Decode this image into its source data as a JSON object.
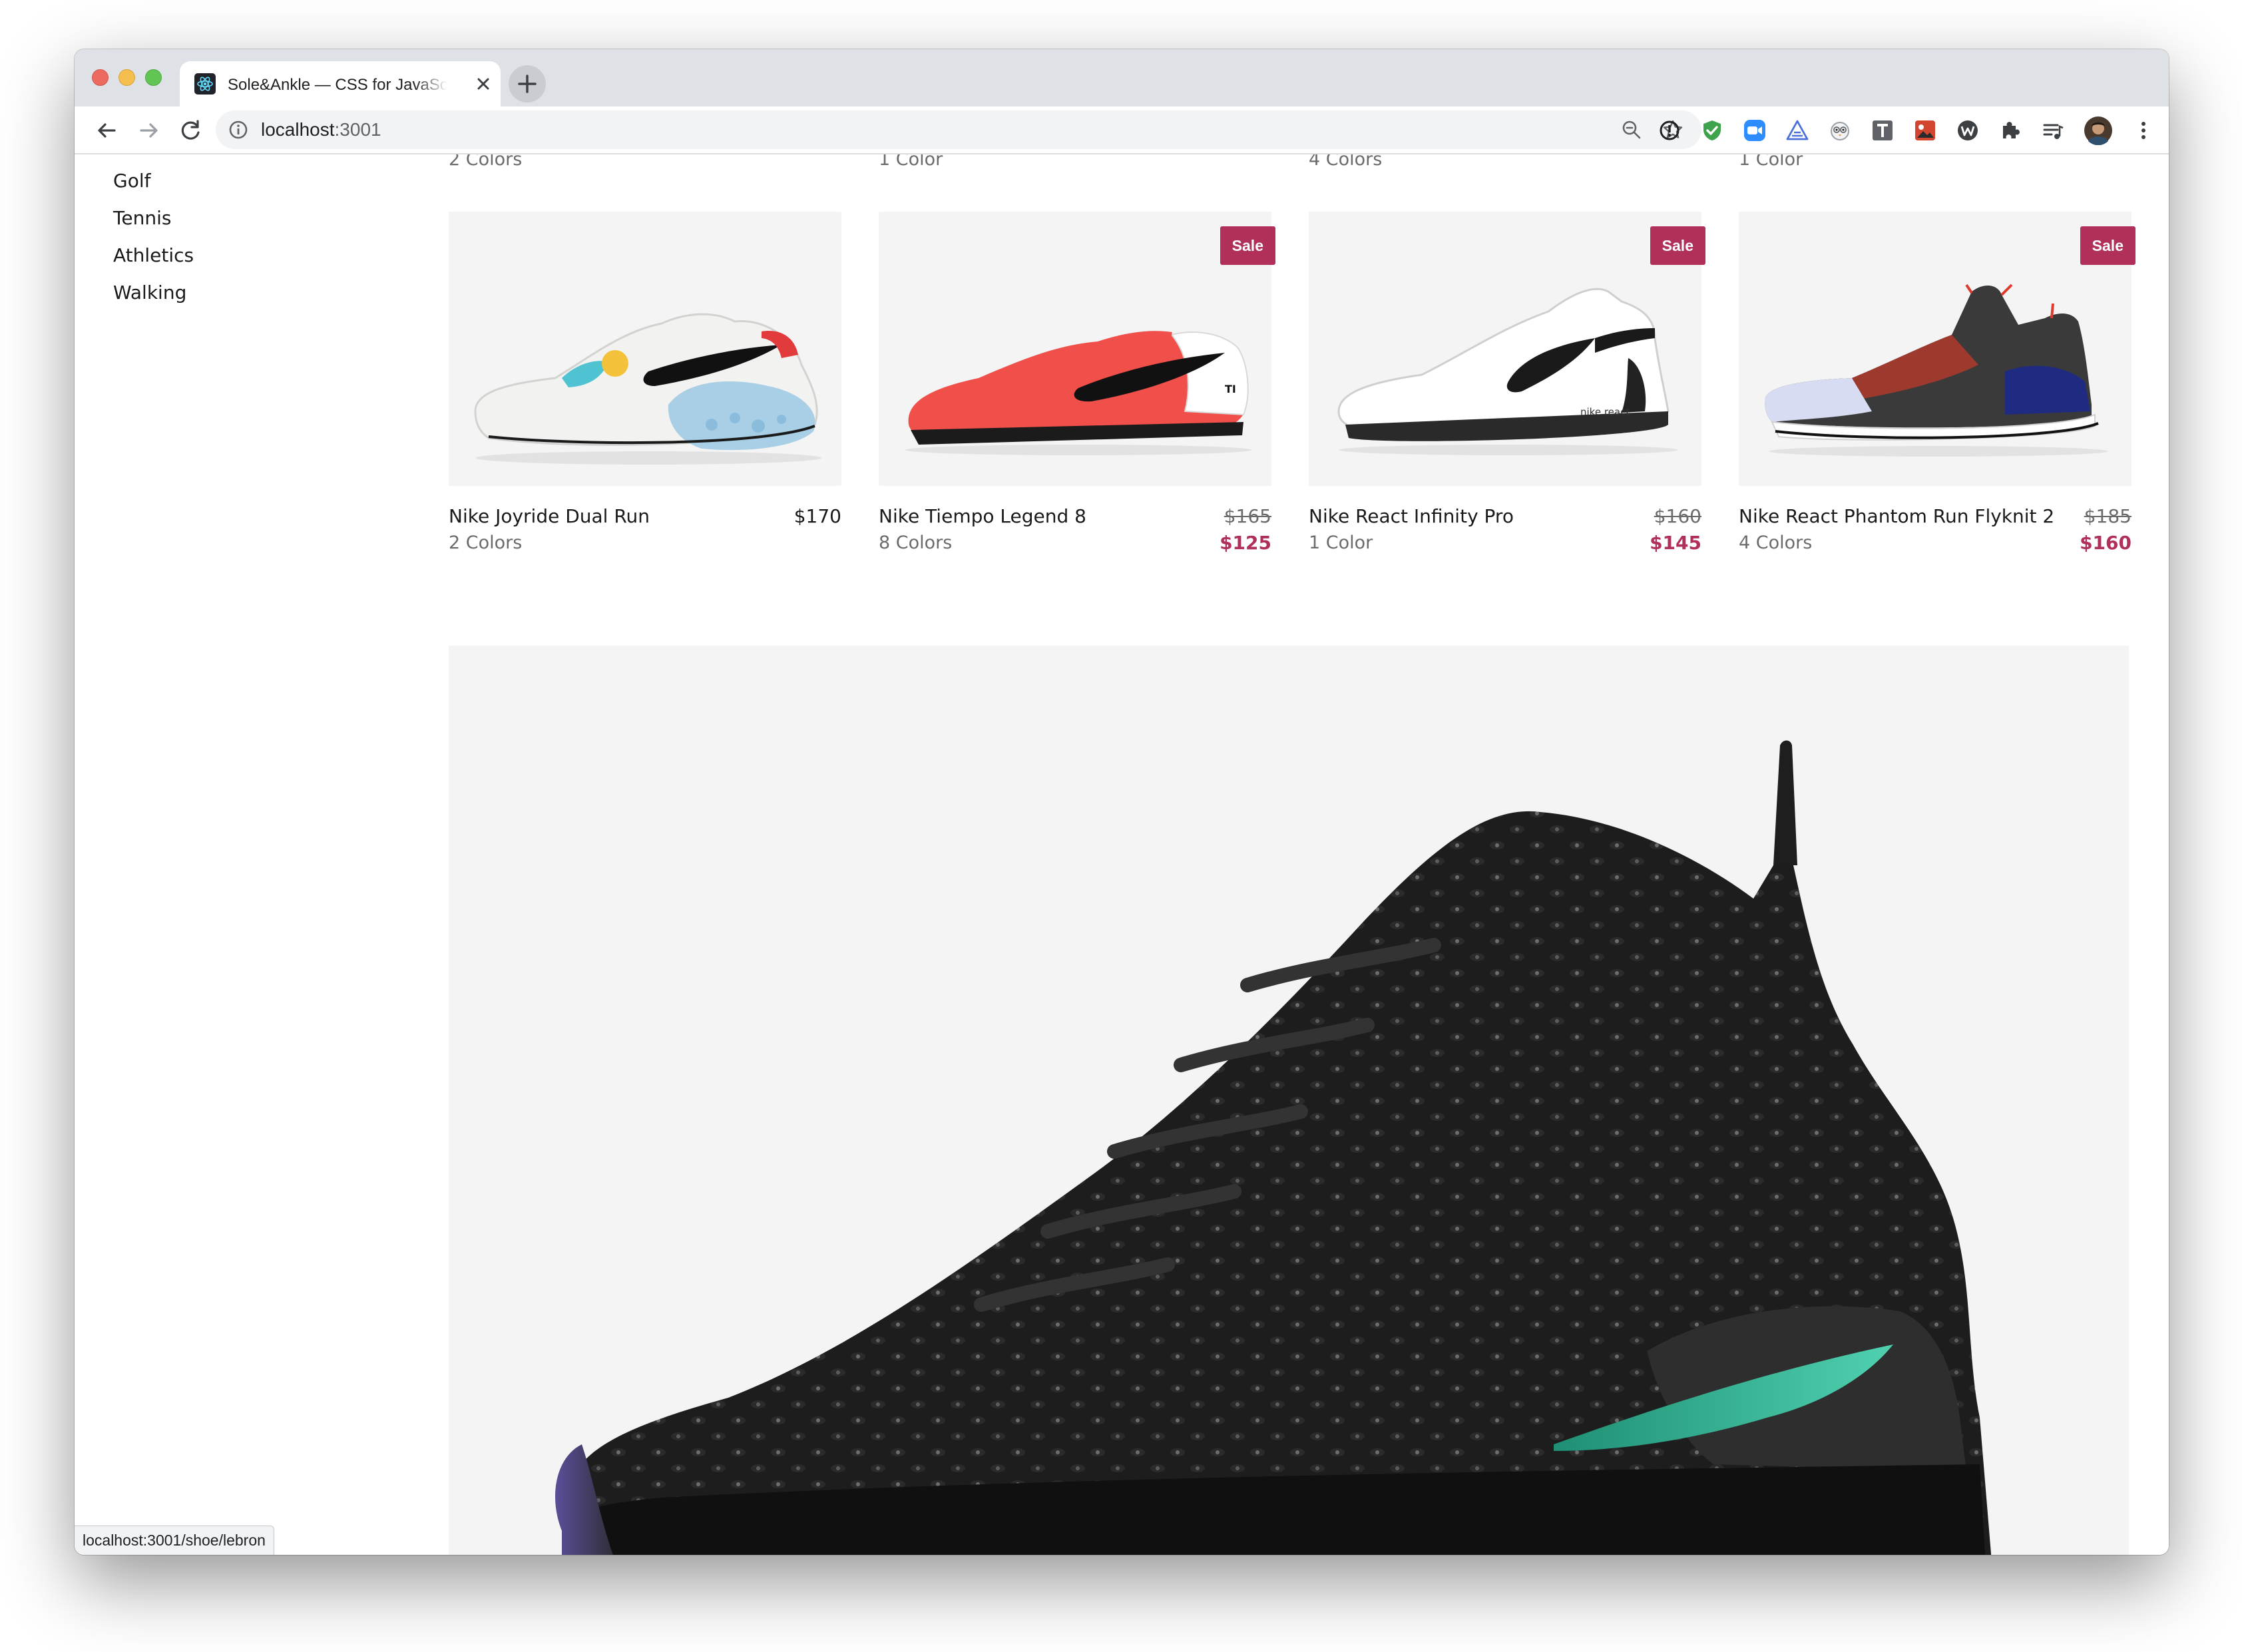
{
  "browser": {
    "tab_title": "Sole&Ankle — CSS for JavaScript Developers",
    "tab_favicon": "react-atom-icon",
    "url_host": "localhost",
    "url_port": ":3001",
    "status_url": "localhost:3001/shoe/lebron",
    "extensions": [
      "info-circle-icon",
      "shield-check-icon",
      "zoom-camera-icon",
      "triangle-warning-icon",
      "owl-icon",
      "t-box-icon",
      "image-extension-icon",
      "w-circle-icon",
      "puzzle-icon",
      "playlist-icon",
      "profile-avatar",
      "more-vert-icon"
    ]
  },
  "sidebar": {
    "links": [
      {
        "label": "Golf"
      },
      {
        "label": "Tennis"
      },
      {
        "label": "Athletics"
      },
      {
        "label": "Walking"
      }
    ]
  },
  "previous_row": {
    "colors": [
      "2 Colors",
      "1 Color",
      "4 Colors",
      "1 Color"
    ]
  },
  "products": [
    {
      "name": "Nike Joyride Dual Run",
      "colors": "2 Colors",
      "price": "$170",
      "sale_price": null,
      "badge": null
    },
    {
      "name": "Nike Tiempo Legend 8",
      "colors": "8 Colors",
      "price": "$165",
      "sale_price": "$125",
      "badge": "Sale"
    },
    {
      "name": "Nike React Infinity Pro",
      "colors": "1 Color",
      "price": "$160",
      "sale_price": "$145",
      "badge": "Sale"
    },
    {
      "name": "Nike React Phantom Run Flyknit 2",
      "colors": "4 Colors",
      "price": "$185",
      "sale_price": "$160",
      "badge": "Sale"
    }
  ],
  "colors": {
    "sale": "#b0305a",
    "muted_text": "#6b6b6b",
    "image_bg": "#f4f4f4"
  }
}
